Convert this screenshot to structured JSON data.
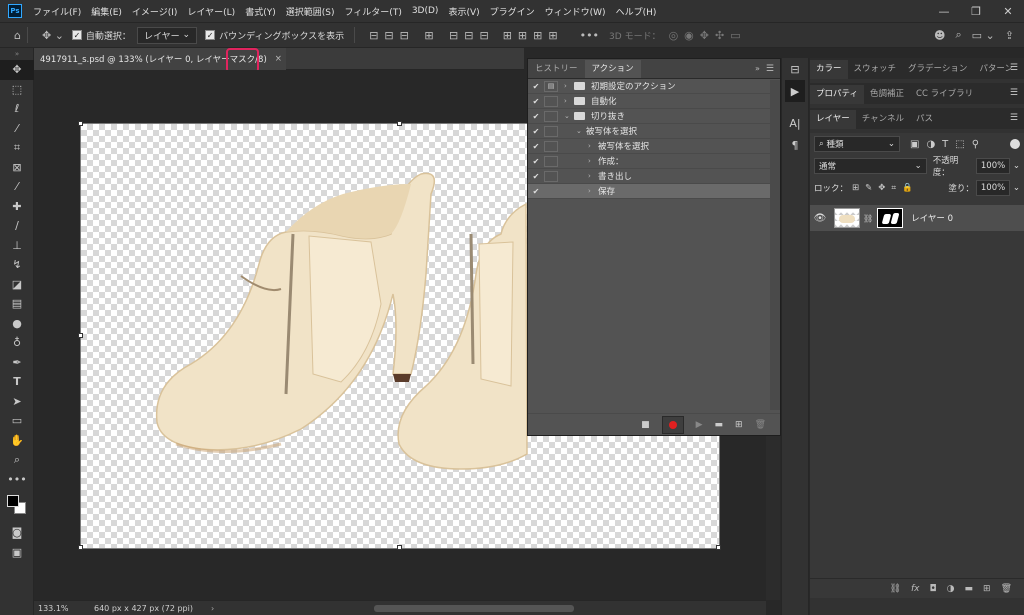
{
  "menubar": {
    "logo": "Ps",
    "items": [
      "ファイル(F)",
      "編集(E)",
      "イメージ(I)",
      "レイヤー(L)",
      "書式(Y)",
      "選択範囲(S)",
      "フィルター(T)",
      "3D(D)",
      "表示(V)",
      "プラグイン",
      "ウィンドウ(W)",
      "ヘルプ(H)"
    ]
  },
  "optbar": {
    "auto_select_label": "自動選択：",
    "auto_select_target": "レイヤー",
    "bounding_box_label": "バウンディングボックスを表示",
    "mode_3d_label": "3D モード："
  },
  "document": {
    "tab_title": "4917911_s.psd @ 133% (レイヤー 0, レイヤーマスク/8)",
    "close_glyph": "×"
  },
  "status": {
    "zoom": "133.1%",
    "dimensions": "640 px x 427 px (72 ppi)"
  },
  "actions_panel": {
    "tabs": [
      "ヒストリー",
      "アクション"
    ],
    "active_tab": "アクション",
    "rows": [
      {
        "label": "初期設定のアクション",
        "indent": 0,
        "type": "set",
        "expanded": false,
        "dialog": "▤"
      },
      {
        "label": "自動化",
        "indent": 0,
        "type": "set",
        "expanded": false,
        "dialog": ""
      },
      {
        "label": "切り抜き",
        "indent": 0,
        "type": "set",
        "expanded": true,
        "dialog": ""
      },
      {
        "label": "被写体を選択",
        "indent": 1,
        "type": "action",
        "expanded": true,
        "dialog": ""
      },
      {
        "label": "被写体を選択",
        "indent": 2,
        "type": "step",
        "expanded": false,
        "dialog": ""
      },
      {
        "label": "作成：",
        "indent": 2,
        "type": "step",
        "expanded": false,
        "dialog": ""
      },
      {
        "label": "書き出し",
        "indent": 2,
        "type": "step",
        "expanded": false,
        "dialog": ""
      },
      {
        "label": "保存",
        "indent": 2,
        "type": "step",
        "expanded": false,
        "dialog": "",
        "selected": true
      }
    ]
  },
  "color_panel": {
    "tabs": [
      "カラー",
      "スウォッチ",
      "グラデーション",
      "パターン"
    ]
  },
  "props_panel": {
    "tabs": [
      "プロパティ",
      "色調補正",
      "CC ライブラリ"
    ]
  },
  "layers_panel": {
    "tabs": [
      "レイヤー",
      "チャンネル",
      "パス"
    ],
    "filter_kind": "種類",
    "blend_mode": "通常",
    "opacity_label": "不透明度：",
    "opacity": "100%",
    "lock_label": "ロック：",
    "fill_label": "塗り：",
    "fill": "100%",
    "layer_name": "レイヤー 0",
    "footer_fx": "fx"
  },
  "colors": {
    "accent_highlight": "#e0245e",
    "record": "#e02020",
    "shoe": "#f2e6cc"
  }
}
